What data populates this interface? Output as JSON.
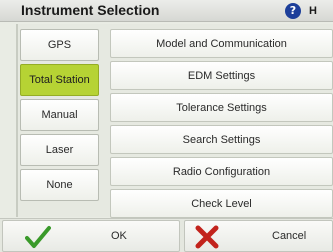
{
  "window": {
    "title": "Instrument Selection",
    "help_label": "H"
  },
  "left_options": [
    {
      "label": "GPS",
      "selected": false
    },
    {
      "label": "Total Station",
      "selected": true
    },
    {
      "label": "Manual",
      "selected": false
    },
    {
      "label": "Laser",
      "selected": false
    },
    {
      "label": "None",
      "selected": false
    }
  ],
  "right_options": [
    {
      "label": "Model and Communication"
    },
    {
      "label": "EDM Settings"
    },
    {
      "label": "Tolerance Settings"
    },
    {
      "label": "Search Settings"
    },
    {
      "label": "Radio Configuration"
    },
    {
      "label": "Check Level"
    }
  ],
  "footer": {
    "ok_label": "OK",
    "cancel_label": "Cancel"
  },
  "colors": {
    "selected": "#b6d334",
    "help_icon": "#1d3f9a",
    "ok_check": "#3a9a2a",
    "cancel_x": "#c2231c"
  }
}
